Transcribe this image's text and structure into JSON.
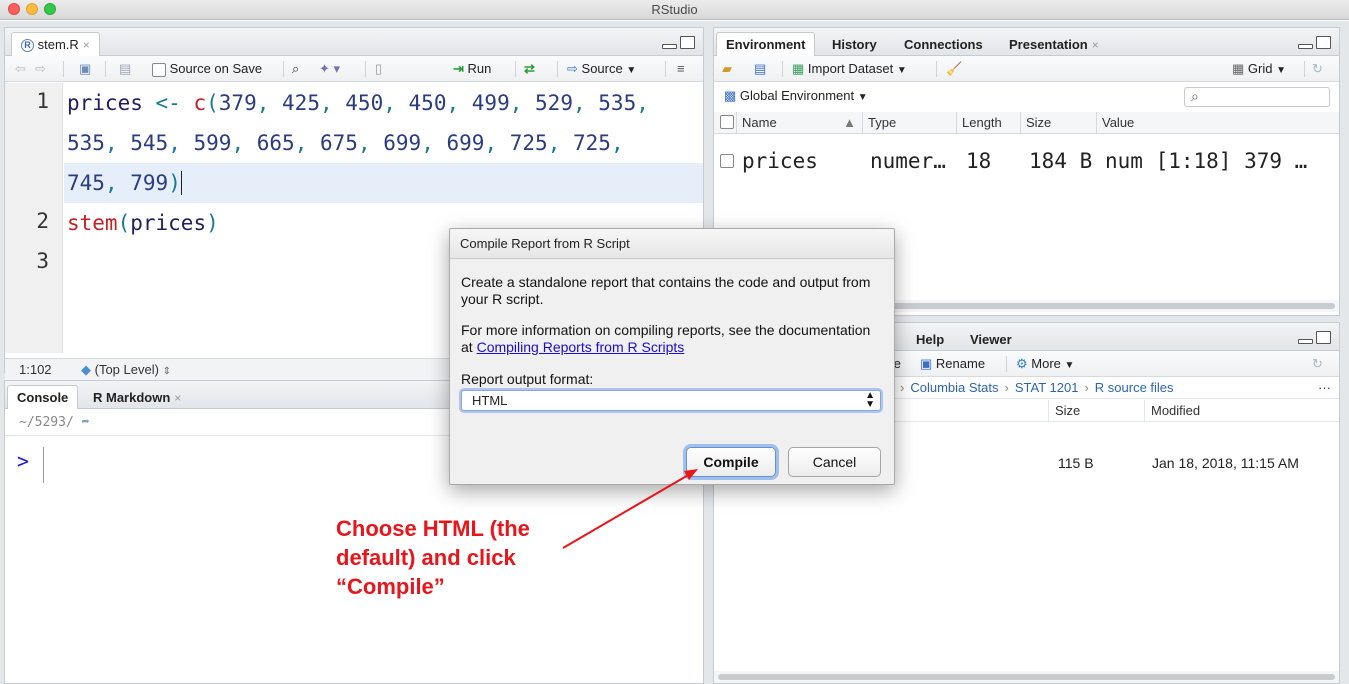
{
  "window": {
    "title": "RStudio"
  },
  "editor": {
    "tab_label": "stem.R",
    "source_on_save": "Source on Save",
    "run_label": "Run",
    "source_label": "Source",
    "line_numbers": [
      "1",
      "2",
      "3"
    ],
    "status_pos": "1:102",
    "status_scope": "(Top Level)"
  },
  "console": {
    "tab_console": "Console",
    "tab_rmarkdown": "R Markdown",
    "working_dir": "~/5293/",
    "prompt": ">"
  },
  "environment": {
    "tabs": [
      "Environment",
      "History",
      "Connections",
      "Presentation"
    ],
    "import_dataset": "Import Dataset",
    "grid_label": "Grid",
    "global_env": "Global Environment",
    "columns": [
      "Name",
      "Type",
      "Length",
      "Size",
      "Value"
    ],
    "row": {
      "name": "prices",
      "type": "numer…",
      "length": "18",
      "size": "184 B",
      "value": "num [1:18] 379 …"
    }
  },
  "files": {
    "tabs": [
      "Help",
      "Viewer"
    ],
    "partial_delete": "te",
    "rename": "Rename",
    "more": "More",
    "breadcrumbs": [
      "Columbia Stats",
      "STAT 1201",
      "R source files"
    ],
    "columns": [
      "Size",
      "Modified"
    ],
    "row": {
      "size": "115 B",
      "modified": "Jan 18, 2018, 11:15 AM"
    }
  },
  "dialog": {
    "title": "Compile Report from R Script",
    "desc": "Create a standalone report that contains the code and output from your R script.",
    "more_info": "For more information on compiling reports, see the documentation at",
    "link": "Compiling Reports from R Scripts",
    "format_label": "Report output format:",
    "format_value": "HTML",
    "compile": "Compile",
    "cancel": "Cancel"
  },
  "annotation": {
    "line1": "Choose HTML (the",
    "line2": "default) and click",
    "line3": "“Compile”"
  }
}
